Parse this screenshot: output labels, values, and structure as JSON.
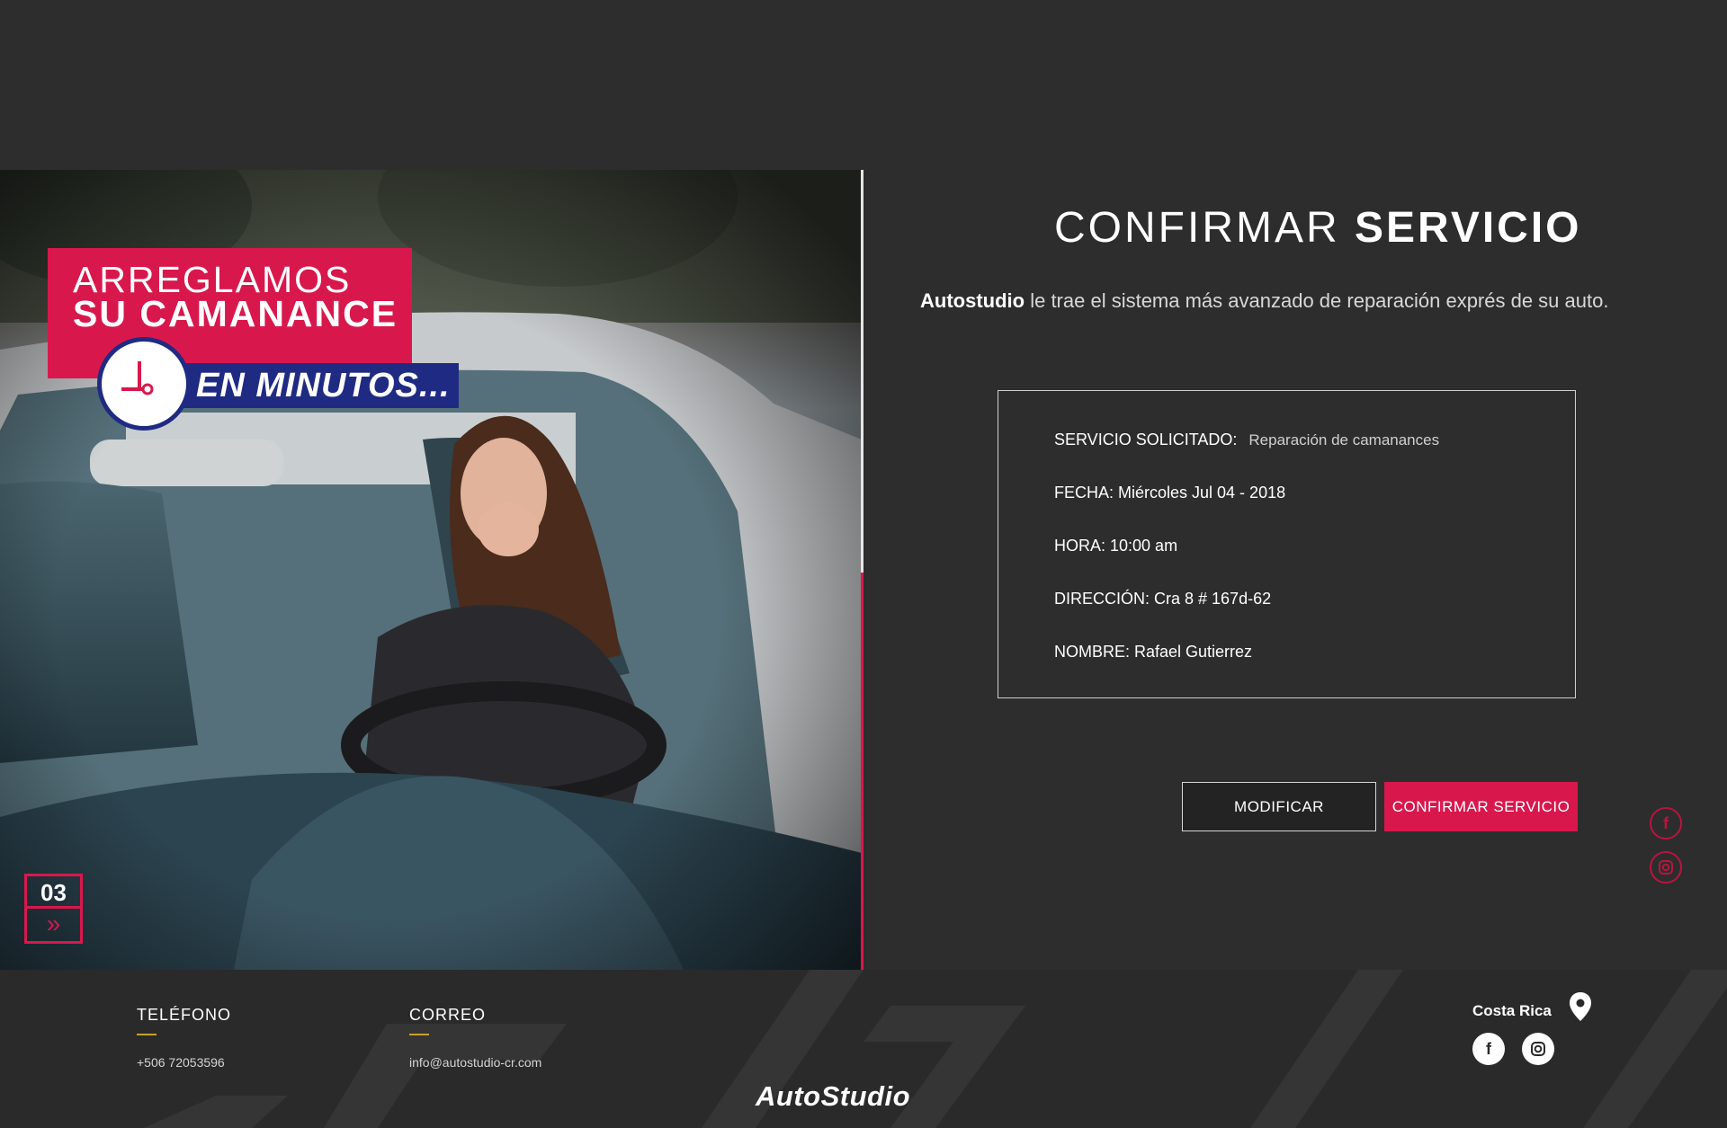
{
  "hero": {
    "headline_line1": "ARREGLAMOS",
    "headline_line2": "SU CAMANANCE",
    "headline_line3": "EN MINUTOS...",
    "slide_number": "03",
    "next_glyph": "»"
  },
  "main": {
    "title_light": "CONFIRMAR",
    "title_bold": "SERVICIO",
    "intro_brand": "Autostudio",
    "intro_text": " le trae el sistema más avanzado de reparación exprés de su auto."
  },
  "summary": {
    "service_label": "SERVICIO SOLICITADO:",
    "service_value": "Reparación de camanances",
    "date": "FECHA: Miércoles Jul 04 - 2018",
    "time": "HORA: 10:00 am",
    "address": "DIRECCIÓN: Cra 8 # 167d-62",
    "name": "NOMBRE: Rafael Gutierrez"
  },
  "actions": {
    "modify_label": "MODIFICAR",
    "confirm_label": "CONFIRMAR SERVICIO"
  },
  "footer": {
    "phone_label": "TELÉFONO",
    "phone_value": "+506 72053596",
    "email_label": "CORREO",
    "email_value": "info@autostudio-cr.com",
    "location": "Costa Rica",
    "brand": "AutoStudio"
  },
  "icons": {
    "facebook": "facebook-icon",
    "instagram": "instagram-icon",
    "location": "map-pin-icon",
    "clock": "clock-icon"
  },
  "colors": {
    "accent": "#d8184d",
    "banner_blue": "#1f2b82",
    "background": "#2d2d2d",
    "footer_bg": "#2a2a2a",
    "underline_gold": "#c9a227"
  }
}
